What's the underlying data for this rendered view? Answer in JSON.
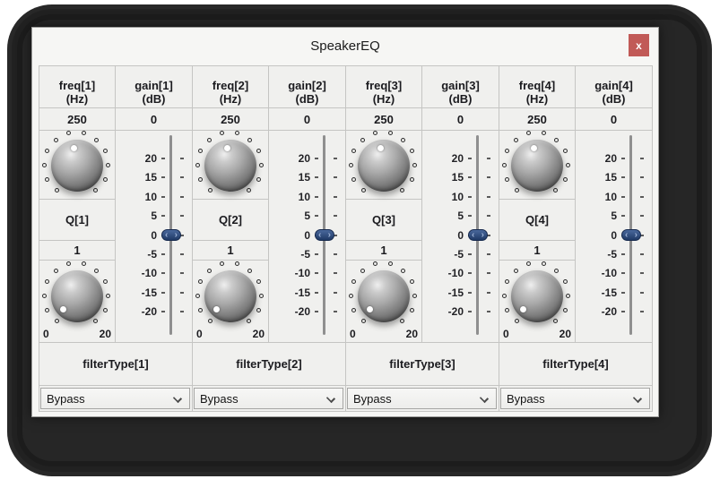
{
  "window": {
    "title": "SpeakerEQ",
    "close_glyph": "x"
  },
  "channels": [
    {
      "freq_label": "freq[1]",
      "freq_unit": "(Hz)",
      "freq_value": "250",
      "gain_label": "gain[1]",
      "gain_unit": "(dB)",
      "gain_value": "0",
      "q_label": "Q[1]",
      "q_value": "1",
      "knob_min": "0",
      "knob_max": "20",
      "filter_label": "filterType[1]",
      "filter_value": "Bypass"
    },
    {
      "freq_label": "freq[2]",
      "freq_unit": "(Hz)",
      "freq_value": "250",
      "gain_label": "gain[2]",
      "gain_unit": "(dB)",
      "gain_value": "0",
      "q_label": "Q[2]",
      "q_value": "1",
      "knob_min": "0",
      "knob_max": "20",
      "filter_label": "filterType[2]",
      "filter_value": "Bypass"
    },
    {
      "freq_label": "freq[3]",
      "freq_unit": "(Hz)",
      "freq_value": "250",
      "gain_label": "gain[3]",
      "gain_unit": "(dB)",
      "gain_value": "0",
      "q_label": "Q[3]",
      "q_value": "1",
      "knob_min": "0",
      "knob_max": "20",
      "filter_label": "filterType[3]",
      "filter_value": "Bypass"
    },
    {
      "freq_label": "freq[4]",
      "freq_unit": "(Hz)",
      "freq_value": "250",
      "gain_label": "gain[4]",
      "gain_unit": "(dB)",
      "gain_value": "0",
      "q_label": "Q[4]",
      "q_value": "1",
      "knob_min": "0",
      "knob_max": "20",
      "filter_label": "filterType[4]",
      "filter_value": "Bypass"
    }
  ],
  "gain_ticks": [
    "20",
    "15",
    "10",
    "5",
    "0",
    "-5",
    "-10",
    "-15",
    "-20"
  ],
  "slider_thumb_position_tick": "0",
  "colors": {
    "close_button": "#c15a57",
    "slider_thumb": "#2f4d7e",
    "backdrop": "#262626",
    "panel": "#f0f0ee"
  }
}
